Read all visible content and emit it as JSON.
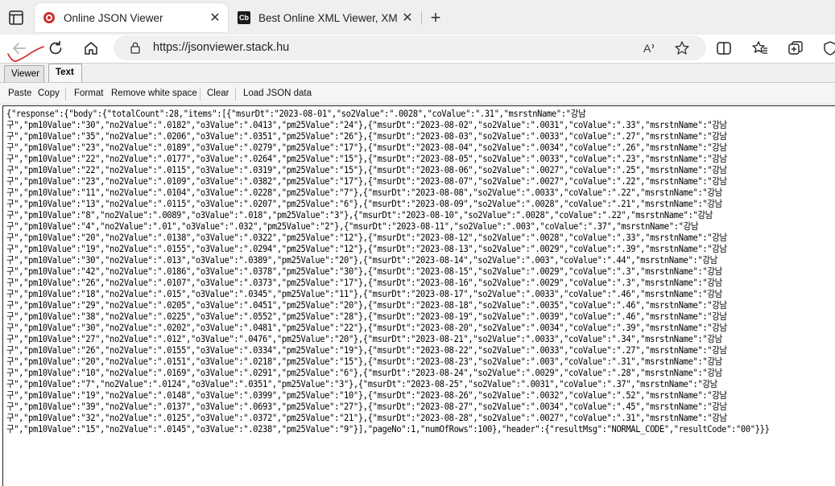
{
  "browser": {
    "tabs": [
      {
        "title": "Online JSON Viewer",
        "favicon": "json-viewer-favicon",
        "active": true,
        "close": "✕"
      },
      {
        "title": "Best Online XML Viewer, XML Fo",
        "favicon": "codebeautify-favicon",
        "favicon_text": "Cb",
        "active": false,
        "close": "✕"
      }
    ],
    "new_tab": "+",
    "url": "https://jsonviewer.stack.hu"
  },
  "viewer_tabs": [
    {
      "label": "Viewer"
    },
    {
      "label": "Text"
    }
  ],
  "toolbar": {
    "paste": "Paste",
    "copy": "Copy",
    "format": "Format",
    "remove_ws": "Remove white space",
    "clear": "Clear",
    "load_json": "Load JSON data"
  },
  "json_lines": [
    "{\"response\":{\"body\":{\"totalCount\":28,\"items\":[{\"msurDt\":\"2023-08-01\",\"so2Value\":\".0028\",\"coValue\":\".31\",\"msrstnName\":\"강남",
    "구\",\"pm10Value\":\"30\",\"no2Value\":\".0182\",\"o3Value\":\".0413\",\"pm25Value\":\"24\"},{\"msurDt\":\"2023-08-02\",\"so2Value\":\".0031\",\"coValue\":\".33\",\"msrstnName\":\"강남",
    "구\",\"pm10Value\":\"35\",\"no2Value\":\".0206\",\"o3Value\":\".0351\",\"pm25Value\":\"26\"},{\"msurDt\":\"2023-08-03\",\"so2Value\":\".0033\",\"coValue\":\".27\",\"msrstnName\":\"강남",
    "구\",\"pm10Value\":\"23\",\"no2Value\":\".0189\",\"o3Value\":\".0279\",\"pm25Value\":\"17\"},{\"msurDt\":\"2023-08-04\",\"so2Value\":\".0034\",\"coValue\":\".26\",\"msrstnName\":\"강남",
    "구\",\"pm10Value\":\"22\",\"no2Value\":\".0177\",\"o3Value\":\".0264\",\"pm25Value\":\"15\"},{\"msurDt\":\"2023-08-05\",\"so2Value\":\".0033\",\"coValue\":\".23\",\"msrstnName\":\"강남",
    "구\",\"pm10Value\":\"22\",\"no2Value\":\".0115\",\"o3Value\":\".0319\",\"pm25Value\":\"15\"},{\"msurDt\":\"2023-08-06\",\"so2Value\":\".0027\",\"coValue\":\".25\",\"msrstnName\":\"강남",
    "구\",\"pm10Value\":\"23\",\"no2Value\":\".0109\",\"o3Value\":\".0382\",\"pm25Value\":\"17\"},{\"msurDt\":\"2023-08-07\",\"so2Value\":\".0027\",\"coValue\":\".22\",\"msrstnName\":\"강남",
    "구\",\"pm10Value\":\"11\",\"no2Value\":\".0104\",\"o3Value\":\".0228\",\"pm25Value\":\"7\"},{\"msurDt\":\"2023-08-08\",\"so2Value\":\".0033\",\"coValue\":\".22\",\"msrstnName\":\"강남",
    "구\",\"pm10Value\":\"13\",\"no2Value\":\".0115\",\"o3Value\":\".0207\",\"pm25Value\":\"6\"},{\"msurDt\":\"2023-08-09\",\"so2Value\":\".0028\",\"coValue\":\".21\",\"msrstnName\":\"강남",
    "구\",\"pm10Value\":\"8\",\"no2Value\":\".0089\",\"o3Value\":\".018\",\"pm25Value\":\"3\"},{\"msurDt\":\"2023-08-10\",\"so2Value\":\".0028\",\"coValue\":\".22\",\"msrstnName\":\"강남",
    "구\",\"pm10Value\":\"4\",\"no2Value\":\".01\",\"o3Value\":\".032\",\"pm25Value\":\"2\"},{\"msurDt\":\"2023-08-11\",\"so2Value\":\".003\",\"coValue\":\".37\",\"msrstnName\":\"강남",
    "구\",\"pm10Value\":\"20\",\"no2Value\":\".0138\",\"o3Value\":\".0322\",\"pm25Value\":\"12\"},{\"msurDt\":\"2023-08-12\",\"so2Value\":\".0028\",\"coValue\":\".33\",\"msrstnName\":\"강남",
    "구\",\"pm10Value\":\"19\",\"no2Value\":\".0155\",\"o3Value\":\".0294\",\"pm25Value\":\"12\"},{\"msurDt\":\"2023-08-13\",\"so2Value\":\".0029\",\"coValue\":\".39\",\"msrstnName\":\"강남",
    "구\",\"pm10Value\":\"30\",\"no2Value\":\".013\",\"o3Value\":\".0389\",\"pm25Value\":\"20\"},{\"msurDt\":\"2023-08-14\",\"so2Value\":\".003\",\"coValue\":\".44\",\"msrstnName\":\"강남",
    "구\",\"pm10Value\":\"42\",\"no2Value\":\".0186\",\"o3Value\":\".0378\",\"pm25Value\":\"30\"},{\"msurDt\":\"2023-08-15\",\"so2Value\":\".0029\",\"coValue\":\".3\",\"msrstnName\":\"강남",
    "구\",\"pm10Value\":\"26\",\"no2Value\":\".0107\",\"o3Value\":\".0373\",\"pm25Value\":\"17\"},{\"msurDt\":\"2023-08-16\",\"so2Value\":\".0029\",\"coValue\":\".3\",\"msrstnName\":\"강남",
    "구\",\"pm10Value\":\"18\",\"no2Value\":\".015\",\"o3Value\":\".0345\",\"pm25Value\":\"11\"},{\"msurDt\":\"2023-08-17\",\"so2Value\":\".0033\",\"coValue\":\".46\",\"msrstnName\":\"강남",
    "구\",\"pm10Value\":\"29\",\"no2Value\":\".0205\",\"o3Value\":\".0451\",\"pm25Value\":\"20\"},{\"msurDt\":\"2023-08-18\",\"so2Value\":\".0035\",\"coValue\":\".46\",\"msrstnName\":\"강남",
    "구\",\"pm10Value\":\"38\",\"no2Value\":\".0225\",\"o3Value\":\".0552\",\"pm25Value\":\"28\"},{\"msurDt\":\"2023-08-19\",\"so2Value\":\".0039\",\"coValue\":\".46\",\"msrstnName\":\"강남",
    "구\",\"pm10Value\":\"30\",\"no2Value\":\".0202\",\"o3Value\":\".0481\",\"pm25Value\":\"22\"},{\"msurDt\":\"2023-08-20\",\"so2Value\":\".0034\",\"coValue\":\".39\",\"msrstnName\":\"강남",
    "구\",\"pm10Value\":\"27\",\"no2Value\":\".012\",\"o3Value\":\".0476\",\"pm25Value\":\"20\"},{\"msurDt\":\"2023-08-21\",\"so2Value\":\".0033\",\"coValue\":\".34\",\"msrstnName\":\"강남",
    "구\",\"pm10Value\":\"26\",\"no2Value\":\".0155\",\"o3Value\":\".0334\",\"pm25Value\":\"19\"},{\"msurDt\":\"2023-08-22\",\"so2Value\":\".0033\",\"coValue\":\".27\",\"msrstnName\":\"강남",
    "구\",\"pm10Value\":\"20\",\"no2Value\":\".0151\",\"o3Value\":\".0218\",\"pm25Value\":\"15\"},{\"msurDt\":\"2023-08-23\",\"so2Value\":\".003\",\"coValue\":\".31\",\"msrstnName\":\"강남",
    "구\",\"pm10Value\":\"10\",\"no2Value\":\".0169\",\"o3Value\":\".0291\",\"pm25Value\":\"6\"},{\"msurDt\":\"2023-08-24\",\"so2Value\":\".0029\",\"coValue\":\".28\",\"msrstnName\":\"강남",
    "구\",\"pm10Value\":\"7\",\"no2Value\":\".0124\",\"o3Value\":\".0351\",\"pm25Value\":\"3\"},{\"msurDt\":\"2023-08-25\",\"so2Value\":\".0031\",\"coValue\":\".37\",\"msrstnName\":\"강남",
    "구\",\"pm10Value\":\"19\",\"no2Value\":\".0148\",\"o3Value\":\".0399\",\"pm25Value\":\"10\"},{\"msurDt\":\"2023-08-26\",\"so2Value\":\".0032\",\"coValue\":\".52\",\"msrstnName\":\"강남",
    "구\",\"pm10Value\":\"39\",\"no2Value\":\".0137\",\"o3Value\":\".0693\",\"pm25Value\":\"27\"},{\"msurDt\":\"2023-08-27\",\"so2Value\":\".0034\",\"coValue\":\".45\",\"msrstnName\":\"강남",
    "구\",\"pm10Value\":\"32\",\"no2Value\":\".0125\",\"o3Value\":\".0372\",\"pm25Value\":\"21\"},{\"msurDt\":\"2023-08-28\",\"so2Value\":\".0027\",\"coValue\":\".31\",\"msrstnName\":\"강남",
    "구\",\"pm10Value\":\"15\",\"no2Value\":\".0145\",\"o3Value\":\".0238\",\"pm25Value\":\"9\"}],\"pageNo\":1,\"numOfRows\":100},\"header\":{\"resultMsg\":\"NORMAL_CODE\",\"resultCode\":\"00\"}}}"
  ],
  "colors": {
    "tabstrip_bg": "#efefef",
    "annotation_red": "#d41f1f",
    "favicon_red": "#c9302c"
  }
}
